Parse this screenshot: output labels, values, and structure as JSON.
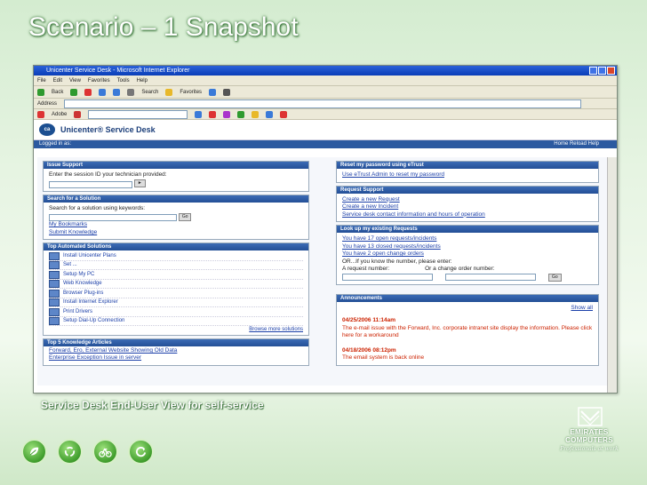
{
  "slide": {
    "title": "Scenario – 1 Snapshot",
    "caption": "Service Desk End-User View for self-service"
  },
  "logo": {
    "line1": "EMIRATES",
    "line2": "COMPUTERS",
    "tagline": "Professionals at work"
  },
  "browser": {
    "window_title": "Unicenter Service Desk - Microsoft Internet Explorer",
    "menu": [
      "File",
      "Edit",
      "View",
      "Favorites",
      "Tools",
      "Help"
    ],
    "toolbar": [
      "Back",
      "Search",
      "Favorites"
    ],
    "address_label": "Address",
    "links_label": "Adobe"
  },
  "app": {
    "logo_text": "ca",
    "name": "Unicenter® Service Desk",
    "user_left": "Logged in as:",
    "user_right": "Home   Reload   Help"
  },
  "left_panels": {
    "issue_support": {
      "header": "Issue Support",
      "text": "Enter the session ID your technician provided:"
    },
    "search": {
      "header": "Search for a Solution",
      "text": "Search for a solution using keywords:",
      "go": "Go",
      "links": [
        "My Bookmarks",
        "Submit Knowledge"
      ]
    },
    "automated": {
      "header": "Top Automated Solutions",
      "items": [
        "Install Unicenter Plans",
        "Set ...",
        "Setup My PC",
        "Web Knowledge",
        "Browser Plug-ins",
        "Install Internet Explorer",
        "Print Drivers",
        "Setup Dial-Up Connection"
      ],
      "more": "Browse more solutions"
    },
    "knowledge": {
      "header": "Top 5 Knowledge Articles",
      "items": [
        "Forward, Ero, External Website Showing Old Data",
        "Enterprise Exception Issue in server"
      ]
    }
  },
  "right_panels": {
    "password": {
      "header": "Reset my password using eTrust",
      "item": "Use eTrust Admin to reset my password"
    },
    "request": {
      "header": "Request Support",
      "items": [
        "Create a new Request",
        "Create a new Incident",
        "Service desk contact information and hours of operation"
      ]
    },
    "existing": {
      "header": "Look up my existing Requests",
      "items": [
        "You have 17 open requests/incidents",
        "You have 13 closed requests/incidents",
        "You have 2 open change orders"
      ],
      "or_text": "OR...If you know the number, please enter:",
      "request_label": "A request number:",
      "change_label": "Or a change order number:",
      "go": "Go"
    },
    "announcements": {
      "header": "Announcements",
      "show_all": "Show all",
      "items": [
        {
          "date": "04/25/2006 11:14am",
          "text": "The e-mail issue with the Forward, Inc. corporate intranet site display the information. Please click here for a workaround"
        },
        {
          "date": "04/18/2006 08:12pm",
          "text": "The email system is back online"
        }
      ]
    }
  }
}
